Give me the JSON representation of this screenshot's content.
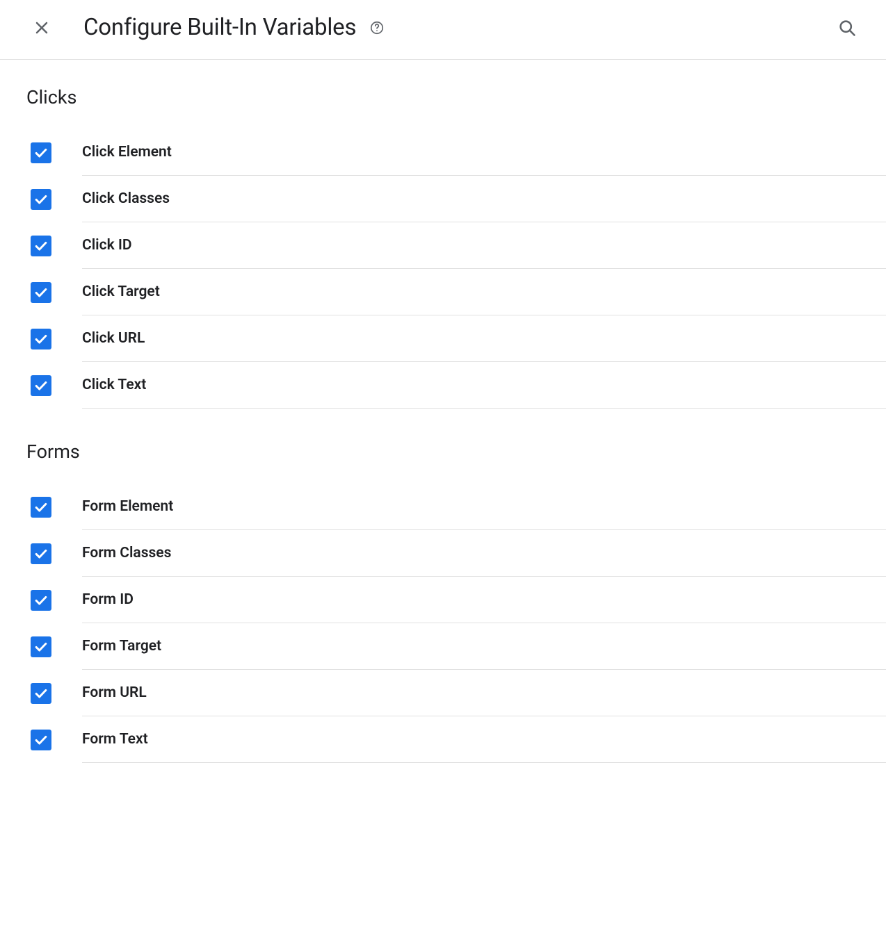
{
  "header": {
    "title": "Configure Built-In Variables"
  },
  "sections": [
    {
      "title": "Clicks",
      "items": [
        {
          "label": "Click Element",
          "checked": true
        },
        {
          "label": "Click Classes",
          "checked": true
        },
        {
          "label": "Click ID",
          "checked": true
        },
        {
          "label": "Click Target",
          "checked": true
        },
        {
          "label": "Click URL",
          "checked": true
        },
        {
          "label": "Click Text",
          "checked": true
        }
      ]
    },
    {
      "title": "Forms",
      "items": [
        {
          "label": "Form Element",
          "checked": true
        },
        {
          "label": "Form Classes",
          "checked": true
        },
        {
          "label": "Form ID",
          "checked": true
        },
        {
          "label": "Form Target",
          "checked": true
        },
        {
          "label": "Form URL",
          "checked": true
        },
        {
          "label": "Form Text",
          "checked": true
        }
      ]
    }
  ]
}
